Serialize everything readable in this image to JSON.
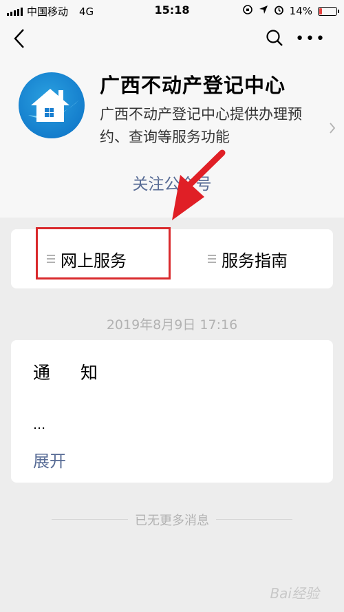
{
  "status_bar": {
    "carrier": "中国移动",
    "network": "4G",
    "time": "15:18",
    "battery": "14%",
    "battery_fraction": 0.14
  },
  "nav": {
    "back_icon": "chevron-left-icon",
    "search_icon": "search-icon",
    "more_icon": "more-icon"
  },
  "account": {
    "name": "广西不动产登记中心",
    "description": "广西不动产登记中心提供办理预约、查询等服务功能",
    "follow_label": "关注公众号",
    "avatar_icon": "house-icon"
  },
  "menu": {
    "items": [
      {
        "label": "网上服务"
      },
      {
        "label": "服务指南"
      }
    ]
  },
  "message": {
    "timestamp": "2019年8月9日 17:16",
    "title": "通 知",
    "ellipsis": "...",
    "expand_label": "展开"
  },
  "footer": {
    "no_more": "已无更多消息"
  },
  "watermark": "Bai经验",
  "colors": {
    "link": "#576b95",
    "highlight": "#d9292c",
    "background": "#ededed"
  }
}
